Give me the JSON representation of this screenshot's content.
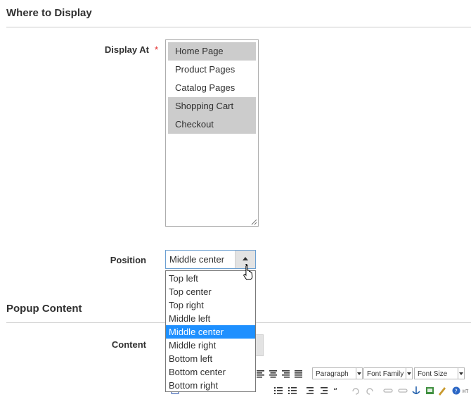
{
  "sections": {
    "where_to_display": "Where to Display",
    "popup_content": "Popup Content"
  },
  "display_at": {
    "label": "Display At",
    "required_mark": "*",
    "options": [
      {
        "label": "Home Page",
        "selected": true
      },
      {
        "label": "Product Pages",
        "selected": false
      },
      {
        "label": "Catalog Pages",
        "selected": false
      },
      {
        "label": "Shopping Cart",
        "selected": true
      },
      {
        "label": "Checkout",
        "selected": true
      }
    ]
  },
  "position": {
    "label": "Position",
    "value": "Middle center",
    "options": [
      "Top left",
      "Top center",
      "Top right",
      "Middle left",
      "Middle center",
      "Middle right",
      "Bottom left",
      "Bottom center",
      "Bottom right"
    ],
    "highlighted": "Middle center"
  },
  "content": {
    "label": "Content"
  },
  "editor_toolbar": {
    "format_select": "Paragraph",
    "font_family_select": "Font Family",
    "font_size_select": "Font Size"
  },
  "colors": {
    "highlight": "#1e90ff",
    "selected_option": "#cccccc",
    "required": "#e22626"
  }
}
